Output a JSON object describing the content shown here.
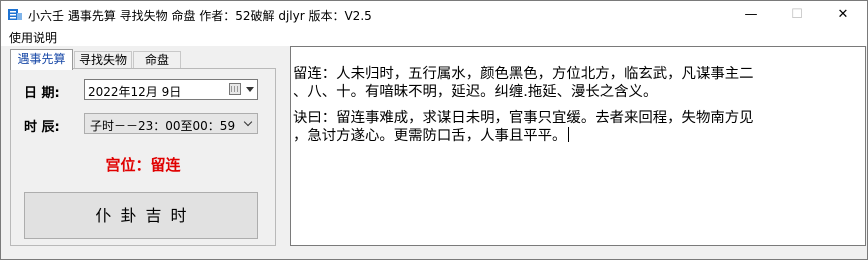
{
  "window": {
    "title": "小六壬 遇事先算 寻找失物 命盘  作者：52破解 djlyr 版本：V2.5",
    "app_icon": "small-app-icon",
    "minimize": "—",
    "maximize": "☐",
    "close": "✕"
  },
  "menu": {
    "items": [
      "使用说明"
    ]
  },
  "tabs": [
    "遇事先算",
    "寻找失物",
    "命盘"
  ],
  "form": {
    "date_label": "日  期:",
    "date_value": "2022年12月  9日",
    "time_label": "时  辰:",
    "time_value": "子时－－23：00至00：59",
    "palace": "宫位：留连",
    "palace_color": "#e00000",
    "divine_button": "仆卦吉时"
  },
  "result": {
    "paragraphs": [
      [
        "留连：人未归时，五行属水，颜色黑色，方位北方，临玄武，凡谋事主二",
        "、八、十。有喑昧不明，延迟。纠缠.拖延、漫长之含义。"
      ],
      [
        "诀曰：留连事难成，求谋日未明，官事只宜缓。去者来回程，失物南方见",
        "，急讨方遂心。更需防口舌，人事且平平。"
      ]
    ]
  }
}
